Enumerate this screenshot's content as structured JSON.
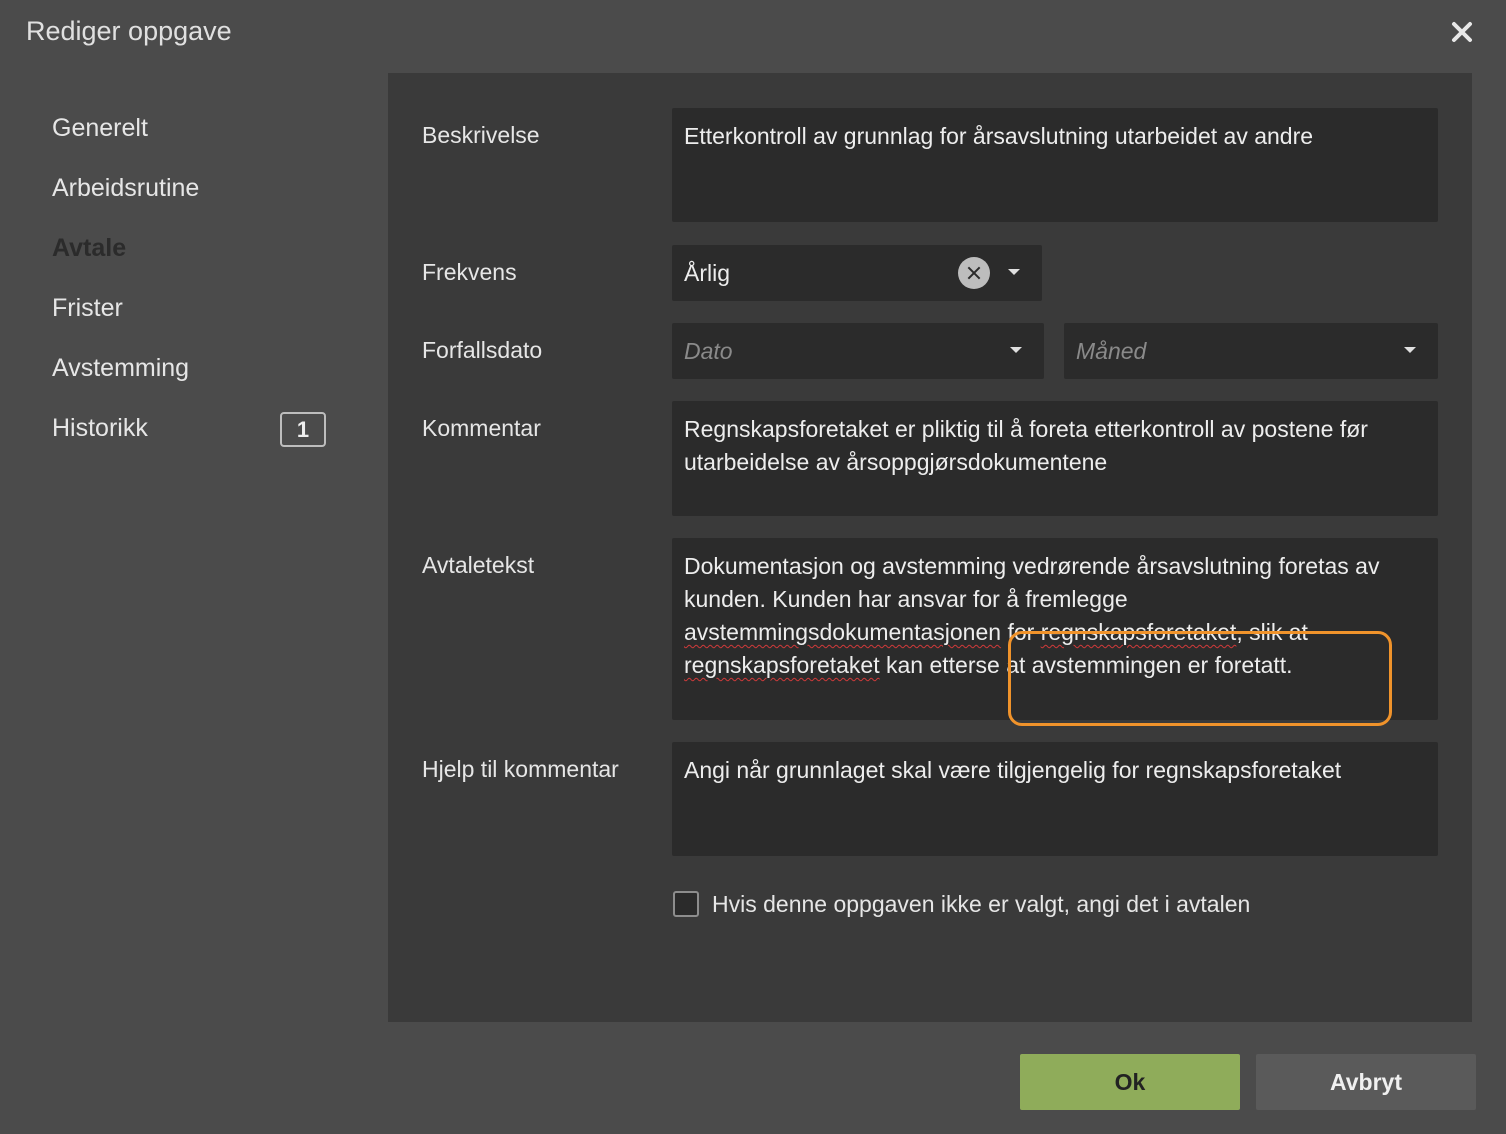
{
  "dialog": {
    "title": "Rediger oppgave"
  },
  "sidebar": {
    "items": [
      {
        "label": "Generelt"
      },
      {
        "label": "Arbeidsrutine"
      },
      {
        "label": "Avtale",
        "active": true
      },
      {
        "label": "Frister"
      },
      {
        "label": "Avstemming"
      },
      {
        "label": "Historikk",
        "badge": "1"
      }
    ]
  },
  "form": {
    "beskrivelse": {
      "label": "Beskrivelse",
      "value": "Etterkontroll av grunnlag for årsavslutning utarbeidet av andre"
    },
    "frekvens": {
      "label": "Frekvens",
      "value": "Årlig"
    },
    "forfallsdato": {
      "label": "Forfallsdato",
      "dato_placeholder": "Dato",
      "maned_placeholder": "Måned"
    },
    "kommentar": {
      "label": "Kommentar",
      "value": "Regnskapsforetaket er pliktig til å foreta etterkontroll av postene før utarbeidelse av årsoppgjørsdokumentene"
    },
    "avtaletekst": {
      "label": "Avtaletekst",
      "part1": "Dokumentasjon og avstemming vedrørende årsavslutning foretas av kunden. Kunden har ansvar for å fremlegge ",
      "misspelled1": "avstemmingsdokumentasjonen",
      "part2": " for ",
      "misspelled2": "regnskapsforetaket",
      "part3": ", slik at ",
      "misspelled3": "regnskapsforetaket",
      "part4": " kan etterse at avstemmingen er foretatt."
    },
    "hjelp": {
      "label": "Hjelp til kommentar",
      "value": "Angi når grunnlaget skal være tilgjengelig for regnskapsforetaket"
    },
    "checkbox": {
      "label": "Hvis denne oppgaven ikke er valgt, angi det i avtalen",
      "checked": false
    }
  },
  "buttons": {
    "ok": "Ok",
    "cancel": "Avbryt"
  },
  "colors": {
    "accent": "#f2b33d",
    "ok": "#8fac5a",
    "highlight": "#f0932b"
  }
}
